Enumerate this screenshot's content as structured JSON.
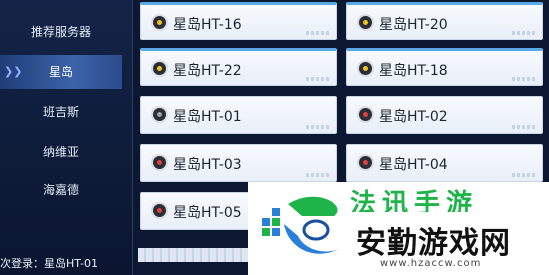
{
  "sidebar": {
    "items": [
      {
        "label": "推荐服务器",
        "active": false
      },
      {
        "label": "星岛",
        "active": true
      },
      {
        "label": "班吉斯",
        "active": false
      },
      {
        "label": "纳维亚",
        "active": false
      },
      {
        "label": "海嘉德",
        "active": false
      }
    ],
    "last_login": "次登录：星岛HT-01"
  },
  "servers": [
    {
      "name": "星岛HT-16",
      "status": "gold"
    },
    {
      "name": "星岛HT-20",
      "status": "gold"
    },
    {
      "name": "星岛HT-22",
      "status": "gold"
    },
    {
      "name": "星岛HT-18",
      "status": "gold"
    },
    {
      "name": "星岛HT-01",
      "status": "gray"
    },
    {
      "name": "星岛HT-02",
      "status": "red"
    },
    {
      "name": "星岛HT-03",
      "status": "red"
    },
    {
      "name": "星岛HT-04",
      "status": "red"
    },
    {
      "name": "星岛HT-05",
      "status": "red"
    }
  ],
  "watermark": {
    "top_text": "法讯手游",
    "main_text": "安勤游戏网",
    "url": "www.hzaccw.com"
  },
  "colors": {
    "gold": "#f1c21b",
    "gray": "#9aa3b2",
    "red": "#e0413a",
    "accent": "#5aa8e8"
  }
}
